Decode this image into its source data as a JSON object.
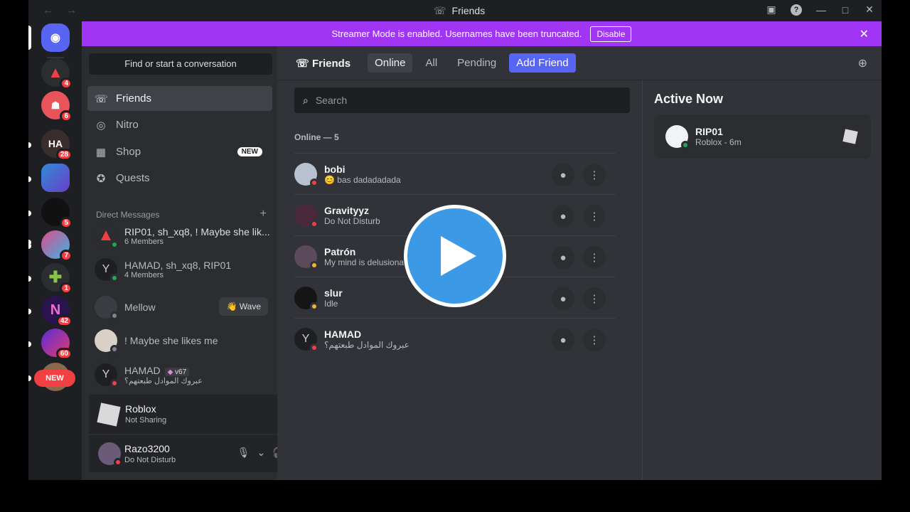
{
  "window": {
    "title": "Friends",
    "back": "←",
    "forward": "→",
    "min": "—",
    "max": "□",
    "close": "✕"
  },
  "banner": {
    "text": "Streamer Mode is enabled. Usernames have been truncated.",
    "button": "Disable",
    "close": "✕"
  },
  "guilds": [
    {
      "badge": "4"
    },
    {
      "badge": "6"
    },
    {
      "label": "HA",
      "badge": "28"
    },
    {
      "badge": ""
    },
    {
      "badge": "5"
    },
    {
      "badge": "7"
    },
    {
      "badge": "1"
    },
    {
      "label": "N",
      "badge": "42"
    },
    {
      "badge": "60"
    }
  ],
  "new_pill": "NEW",
  "sidebar": {
    "find": "Find or start a conversation",
    "nav": [
      {
        "label": "Friends"
      },
      {
        "label": "Nitro"
      },
      {
        "label": "Shop",
        "badge": "NEW"
      },
      {
        "label": "Quests"
      }
    ],
    "dm_header": "Direct Messages",
    "dm_add": "+",
    "dms": [
      {
        "name": "RIP01, sh_xq8, ! Maybe she lik...",
        "sub": "6 Members"
      },
      {
        "name": "HAMAD, sh_xq8, RIP01",
        "sub": "4 Members"
      },
      {
        "name": "Mellow",
        "sub": "",
        "wave": "👋 Wave"
      },
      {
        "name": "! Maybe she likes me",
        "sub": ""
      },
      {
        "name": "HAMAD",
        "tag": "v67",
        "sub": "عبروك الموادل طبعتهم؟"
      }
    ]
  },
  "activity": {
    "name": "Roblox",
    "sub": "Not Sharing"
  },
  "user": {
    "name": "Razo3200",
    "status": "Do Not Disturb"
  },
  "topbar": {
    "title": "Friends",
    "tabs": [
      "Online",
      "All",
      "Pending"
    ],
    "add": "Add Friend"
  },
  "search": {
    "placeholder": "Search"
  },
  "online_label": "Online — 5",
  "friends": [
    {
      "name": "bobi",
      "status": "😊 bas dadadadada"
    },
    {
      "name": "Gravityyz",
      "status": "Do Not Disturb"
    },
    {
      "name": "Patrón",
      "status": "My mind is delusiona"
    },
    {
      "name": "slur",
      "status": "Idle"
    },
    {
      "name": "HAMAD",
      "status": "عبروك الموادل طبعتهم؟"
    }
  ],
  "active_now": {
    "title": "Active Now",
    "name": "RIP01",
    "sub": "Roblox - 6m"
  },
  "colors": {
    "blurple": "#5865f2",
    "streamer": "#a135f4",
    "online": "#23a55a",
    "dnd": "#f23f43",
    "idle": "#f0b232",
    "play": "#3b99e6"
  }
}
